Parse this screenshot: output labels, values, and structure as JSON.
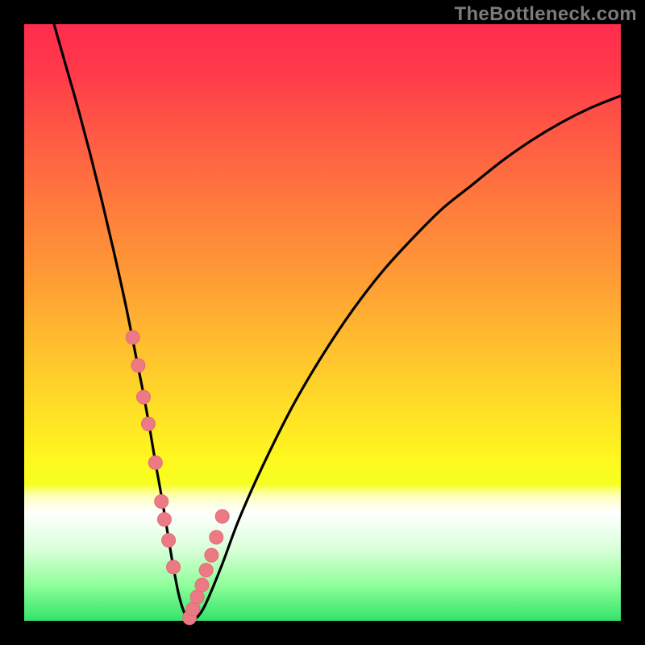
{
  "watermark": "TheBottleneck.com",
  "colors": {
    "frame": "#000000",
    "curve": "#000000",
    "marker_fill": "#ec7a85",
    "marker_stroke": "#e46a76",
    "gradient_top": "#ff2c4d",
    "gradient_bottom": "#32e36a"
  },
  "chart_data": {
    "type": "line",
    "title": "",
    "xlabel": "",
    "ylabel": "",
    "xlim": [
      0,
      100
    ],
    "ylim": [
      0,
      100
    ],
    "grid": false,
    "legend": false,
    "series": [
      {
        "name": "bottleneck-curve",
        "type": "line",
        "x": [
          5,
          7,
          9,
          11,
          13,
          15,
          17,
          19,
          20,
          21,
          22,
          23,
          24,
          25,
          26,
          27,
          28,
          30,
          33,
          36,
          40,
          45,
          50,
          55,
          60,
          65,
          70,
          75,
          80,
          85,
          90,
          95,
          100
        ],
        "y": [
          100,
          93,
          86,
          78.5,
          70.5,
          62,
          53,
          43,
          38,
          32.5,
          26.5,
          21,
          15,
          9,
          4,
          1,
          0,
          2,
          9,
          17,
          26,
          36,
          44.5,
          52,
          58.5,
          64,
          69,
          73,
          77,
          80.5,
          83.5,
          86,
          88
        ]
      },
      {
        "name": "markers",
        "type": "scatter",
        "x": [
          18.2,
          19.1,
          20.0,
          20.8,
          22.0,
          23.0,
          23.5,
          24.2,
          25.0,
          27.7,
          28.3,
          29.0,
          29.8,
          30.5,
          31.4,
          32.2,
          33.2
        ],
        "y": [
          47.5,
          42.8,
          37.5,
          33.0,
          26.5,
          20.0,
          17.0,
          13.5,
          9.0,
          0.5,
          2.0,
          4.0,
          6.0,
          8.5,
          11.0,
          14.0,
          17.5
        ]
      }
    ]
  }
}
